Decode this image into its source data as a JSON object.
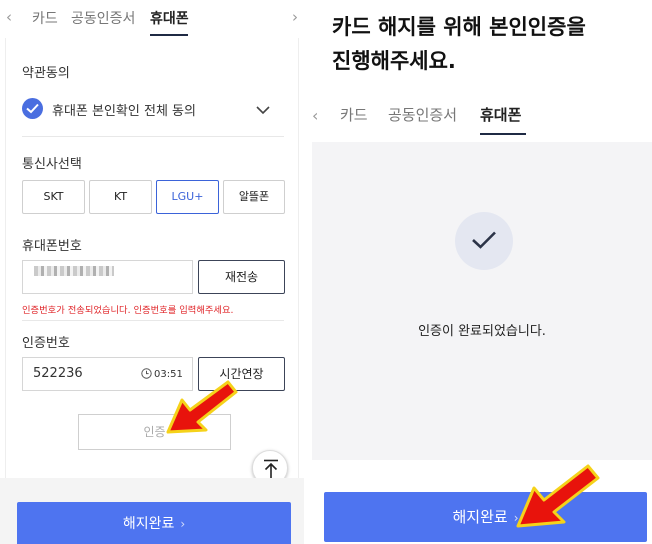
{
  "left": {
    "tabs": {
      "prev": "‹",
      "next": "›",
      "items": [
        "카드",
        "공동인증서",
        "휴대폰"
      ],
      "active_index": 2
    },
    "terms": {
      "title": "약관동의",
      "agree_label": "휴대폰 본인확인 전체 동의"
    },
    "carrier": {
      "title": "통신사선택",
      "options": [
        "SKT",
        "KT",
        "LGU+",
        "알뜰폰"
      ],
      "selected": "LGU+"
    },
    "phone": {
      "title": "휴대폰번호",
      "resend_label": "재전송",
      "error": "인증번호가 전송되었습니다. 인증번호를 입력해주세요."
    },
    "code": {
      "title": "인증번호",
      "value": "522236",
      "timer": "03:51",
      "extend_label": "시간연장"
    },
    "verify_label": "인증",
    "submit_label": "해지완료"
  },
  "right": {
    "headline_line1": "카드 해지를 위해 본인인증을",
    "headline_line2": "진행해주세요.",
    "tabs": {
      "prev": "‹",
      "items": [
        "카드",
        "공동인증서",
        "휴대폰"
      ],
      "active_index": 2
    },
    "done_text": "인증이 완료되었습니다.",
    "submit_label": "해지완료"
  },
  "colors": {
    "accent": "#4e74f0",
    "error": "#e0262a",
    "arrow": "#e8130c"
  },
  "icons": [
    "check-icon",
    "chevron-down-icon",
    "clock-icon",
    "scroll-top-icon",
    "red-pointer-arrow"
  ]
}
